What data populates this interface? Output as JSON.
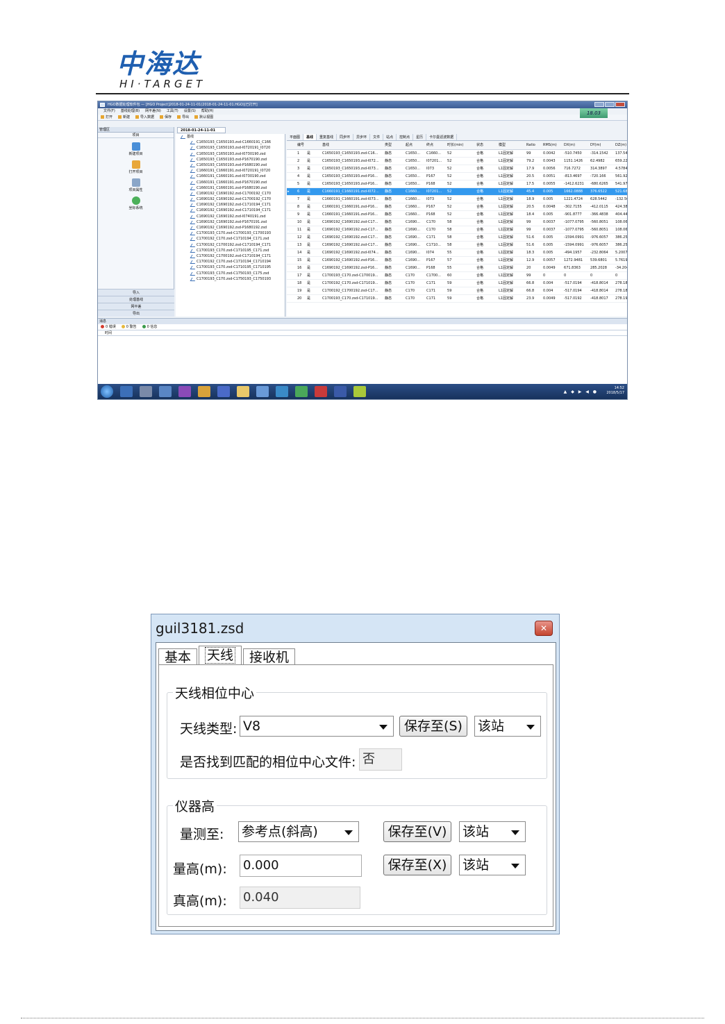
{
  "logo": {
    "cn": "中海达",
    "en": "HI·TARGET"
  },
  "app": {
    "title": "HGO数据处理软件包 — [HGO Project]2018-01-24-11-01(2018-01-24-11-01.HGO)[已打开]",
    "menu": [
      "文件(F)",
      "基线处理(B)",
      "网平差(N)",
      "工具(T)",
      "设置(S)",
      "帮助(H)"
    ],
    "clock_box": "18.03",
    "toolbar": [
      "打开",
      "新建",
      "导入数据",
      "保存",
      "导出",
      "默认视图"
    ],
    "left_pane": {
      "header": "管理区",
      "sub": "项目",
      "items": [
        "新建项目",
        "打开项目",
        "项目属性",
        "坐标系统"
      ],
      "bottom": [
        "导入",
        "处理基线",
        "网平差",
        "导出"
      ]
    },
    "doc_tab": "2018-01-24-11-01",
    "tree": {
      "root": "基线",
      "items": [
        "C1650193_C1650193.zsd-C1660191_C166",
        "C1650193_C1650193.zsd-I0720191_I0720",
        "C1650193_C1650193.zsd-I0730190.zsd",
        "C1650193_C1650193.zsd-P1670190.zsd",
        "C1650193_C1650193.zsd-P1680190.zsd",
        "C1660191_C1660191.zsd-I0720191_I0720",
        "C1660191_C1660191.zsd-I0730190.zsd",
        "C1660191_C1660191.zsd-P1670190.zsd",
        "C1660191_C1660191.zsd-P1680190.zsd",
        "C1690192_C1690192.zsd-C1700192_C170",
        "C1690192_C1690192.zsd-C1700192_C170",
        "C1690192_C1690192.zsd-C1710194_C171",
        "C1690192_C1690192.zsd-C1710194_C171",
        "C1690192_C1690192.zsd-I0740191.zsd",
        "C1690192_C1690192.zsd-P1670191.zsd",
        "C1690192_C1690192.zsd-P1680192.zsd",
        "C1700193_C170.zsd-C1700193_C1700193",
        "C1700192_C170.zsd-C1710194_C171.zsd",
        "C1700192_C1700192.zsd-C1710194_C171",
        "C1700193_C170.zsd-C1710195_C171.zsd",
        "C1700192_C1700192.zsd-C1710194_C171",
        "C1700192_C170.zsd-C1710194_C1710194",
        "C1700193_C170.zsd-C1710195_C1710195",
        "C1700193_C170.zsd-C1750193_C175.zsd",
        "C1700193_C170.zsd-C1750193_C1750193"
      ]
    },
    "grid": {
      "tabs": [
        "平面图",
        "基线",
        "重复基线",
        "同步环",
        "异步环",
        "文件",
        "站点",
        "控制点",
        "星历",
        "卡尔曼滤波数据"
      ],
      "active_tab": "基线",
      "columns": [
        "编号",
        "基线",
        "类型",
        "起点",
        "终点",
        "时长(min)",
        "状态",
        "模型",
        "Ratio",
        "RMS(m)",
        "DX(m)",
        "DY(m)",
        "DZ(m)"
      ],
      "rows": [
        [
          "1",
          "是",
          "C1650193_C1650193.zsd-C16...",
          "静态",
          "C1650...",
          "C1660...",
          "52",
          "合格",
          "L1固定解",
          "99",
          "0.0042",
          "-510.7450",
          "-314.1542",
          "137.540"
        ],
        [
          "2",
          "是",
          "C1650193_C1650193.zsd-I072...",
          "静态",
          "C1650...",
          "I07201...",
          "52",
          "合格",
          "L1固定解",
          "79.2",
          "0.0043",
          "1151.1426",
          "62.4982",
          "659.228"
        ],
        [
          "3",
          "是",
          "C1650193_C1650193.zsd-I073...",
          "静态",
          "C1650...",
          "I073",
          "52",
          "合格",
          "L1固定解",
          "17.9",
          "0.0056",
          "716.7272",
          "314.3897",
          "4.5784"
        ],
        [
          "4",
          "是",
          "C1650193_C1650193.zsd-P16...",
          "静态",
          "C1650...",
          "P167",
          "52",
          "合格",
          "L1固定解",
          "20.5",
          "0.0051",
          "-813.4697",
          "-720.166",
          "561.927"
        ],
        [
          "5",
          "是",
          "C1650193_C1650193.zsd-P16...",
          "静态",
          "C1650...",
          "P168",
          "52",
          "合格",
          "L1固定解",
          "17.5",
          "0.0055",
          "-1412.6231",
          "-680.6265",
          "541.979"
        ],
        [
          "6",
          "是",
          "C1660191_C1660191.zsd-I072...",
          "静态",
          "C1660...",
          "I07201...",
          "52",
          "合格",
          "L1固定解",
          "45.4",
          "0.005",
          "1662.0888",
          "376.6522",
          "521.687"
        ],
        [
          "7",
          "是",
          "C1660191_C1660191.zsd-I073...",
          "静态",
          "C1660...",
          "I073",
          "52",
          "合格",
          "L1固定解",
          "18.9",
          "0.005",
          "1221.4724",
          "628.5442",
          "-132.56"
        ],
        [
          "8",
          "是",
          "C1660191_C1660191.zsd-P16...",
          "静态",
          "C1660...",
          "P167",
          "52",
          "合格",
          "L1固定解",
          "20.5",
          "0.0048",
          "-302.7155",
          "-412.0115",
          "424.386"
        ],
        [
          "9",
          "是",
          "C1660191_C1660191.zsd-P16...",
          "静态",
          "C1660...",
          "P168",
          "52",
          "合格",
          "L1固定解",
          "18.4",
          "0.005",
          "-901.8777",
          "-366.4838",
          "404.440"
        ],
        [
          "10",
          "是",
          "C1690192_C1690192.zsd-C17...",
          "静态",
          "C1690...",
          "C170",
          "58",
          "合格",
          "L1固定解",
          "99",
          "0.0037",
          "-1077.0795",
          "-560.8051",
          "108.067"
        ],
        [
          "11",
          "是",
          "C1690192_C1690192.zsd-C17...",
          "静态",
          "C1690...",
          "C170",
          "58",
          "合格",
          "L1固定解",
          "99",
          "0.0037",
          "-1077.0795",
          "-560.8051",
          "108.067"
        ],
        [
          "12",
          "是",
          "C1690192_C1690192.zsd-C17...",
          "静态",
          "C1690...",
          "C171",
          "58",
          "合格",
          "L1固定解",
          "51.6",
          "0.005",
          "-1594.0991",
          "-976.6057",
          "386.255"
        ],
        [
          "13",
          "是",
          "C1690192_C1690192.zsd-C17...",
          "静态",
          "C1690...",
          "C1710...",
          "58",
          "合格",
          "L1固定解",
          "51.6",
          "0.005",
          "-1594.0991",
          "-976.6057",
          "386.255"
        ],
        [
          "14",
          "是",
          "C1690192_C1690192.zsd-I074...",
          "静态",
          "C1690...",
          "I074",
          "55",
          "合格",
          "L1固定解",
          "18.3",
          "0.005",
          "-494.1957",
          "-232.8064",
          "5.2007"
        ],
        [
          "15",
          "是",
          "C1690192_C1690192.zsd-P16...",
          "静态",
          "C1690...",
          "P167",
          "57",
          "合格",
          "L1固定解",
          "12.9",
          "0.0057",
          "1272.9481",
          "539.6801",
          "5.7619"
        ],
        [
          "16",
          "是",
          "C1690192_C1690192.zsd-P16...",
          "静态",
          "C1690...",
          "P168",
          "55",
          "合格",
          "L1固定解",
          "20",
          "0.0049",
          "671.8363",
          "285.2028",
          "-34.204"
        ],
        [
          "17",
          "是",
          "C1700193_C170.zsd-C170019...",
          "静态",
          "C170",
          "C1700...",
          "60",
          "合格",
          "L1固定解",
          "99",
          "0",
          "0",
          "0",
          "0"
        ],
        [
          "18",
          "是",
          "C1700192_C170.zsd-C171019...",
          "静态",
          "C170",
          "C171",
          "59",
          "合格",
          "L1固定解",
          "66.8",
          "0.004",
          "-517.0194",
          "-418.8014",
          "278.187"
        ],
        [
          "19",
          "是",
          "C1700192_C1700192.zsd-C17...",
          "静态",
          "C170",
          "C171",
          "59",
          "合格",
          "L1固定解",
          "66.8",
          "0.004",
          "-517.0194",
          "-418.8014",
          "278.187"
        ],
        [
          "20",
          "是",
          "C1700193_C170.zsd-C171019...",
          "静态",
          "C170",
          "C171",
          "59",
          "合格",
          "L1固定解",
          "23.9",
          "0.0049",
          "-517.0192",
          "-418.8017",
          "278.191"
        ]
      ],
      "selected_row": 5
    },
    "messages": {
      "header": "消息",
      "filters": [
        "0 错误",
        "0 警告",
        "0 信息"
      ],
      "column": "时间"
    },
    "taskbar": {
      "time": "14:52",
      "date": "2018/5/17"
    }
  },
  "dialog": {
    "title": "guil3181.zsd",
    "tabs": [
      "基本",
      "天线",
      "接收机"
    ],
    "active_tab": "天线",
    "phase_group": {
      "title": "天线相位中心",
      "type_label": "天线类型:",
      "type_value": "V8",
      "save_btn": "保存至(S)",
      "scope_value": "该站",
      "found_label": "是否找到匹配的相位中心文件:",
      "found_value": "否"
    },
    "height_group": {
      "title": "仪器高",
      "measure_label": "量测至:",
      "measure_value": "参考点(斜高)",
      "save_btn_v": "保存至(V)",
      "scope_value_1": "该站",
      "height_label": "量高(m):",
      "height_value": "0.000",
      "save_btn_x": "保存至(X)",
      "scope_value_2": "该站",
      "true_height_label": "真高(m):",
      "true_height_value": "0.040"
    }
  }
}
